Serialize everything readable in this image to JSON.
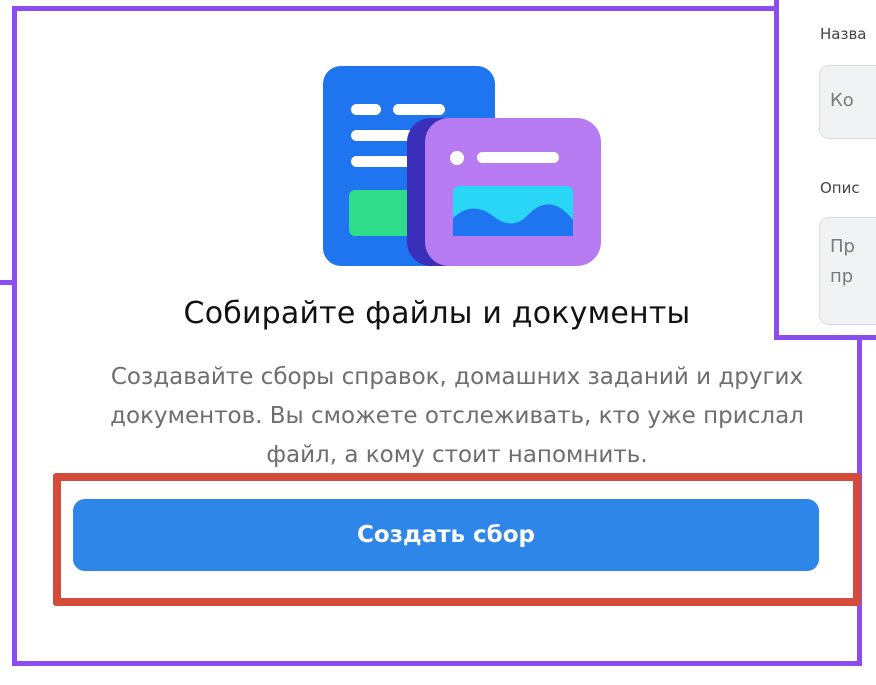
{
  "collection_card": {
    "title": "Собирайте файлы и документы",
    "description": "Создавайте сборы справок, домашних заданий и других документов. Вы сможете отслеживать, кто уже прислал файл, а кому стоит напомнить.",
    "create_button_label": "Создать сбор"
  },
  "form_panel": {
    "name_label": "Назва",
    "name_placeholder": "Ко",
    "description_label": "Опис",
    "description_placeholder_line1": "Пр",
    "description_placeholder_line2": "пр"
  },
  "colors": {
    "accent_blue": "#2d86e8",
    "frame_purple": "#8b4cf0",
    "highlight_red": "#d44b3b"
  },
  "icons": [
    "document-with-image-icon"
  ]
}
